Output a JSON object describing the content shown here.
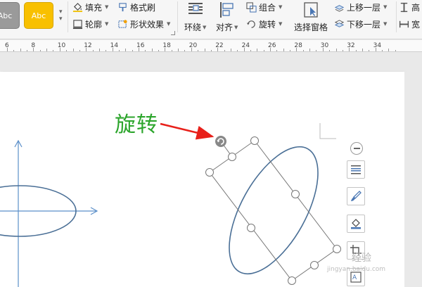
{
  "ribbon": {
    "style_swatches": [
      {
        "label": "Abc",
        "color": "#9a9a9a"
      },
      {
        "label": "Abc",
        "color": "#f8c000"
      }
    ],
    "fill_label": "填充",
    "format_painter_label": "格式刷",
    "outline_label": "轮廓",
    "shape_effects_label": "形状效果",
    "wrap_label": "环绕",
    "align_label": "对齐",
    "group_label": "组合",
    "rotate_label": "旋转",
    "selection_pane_label": "选择窗格",
    "bring_forward_label": "上移一层",
    "send_backward_label": "下移一层",
    "height_label": "高",
    "width_label": "宽"
  },
  "ruler": {
    "numbers": [
      "6",
      "8",
      "10",
      "12",
      "14",
      "16",
      "18",
      "20",
      "22",
      "24",
      "26",
      "28",
      "30",
      "32",
      "34"
    ]
  },
  "document": {
    "annotation_text": "旋转",
    "annotation_color": "#2ca52c",
    "arrow_color": "#e8201a",
    "shape_stroke_color": "#4a6f96",
    "axis_color": "#5b8fc9"
  },
  "watermark": {
    "text": "经验",
    "url": "jingyan.baidu.com"
  }
}
